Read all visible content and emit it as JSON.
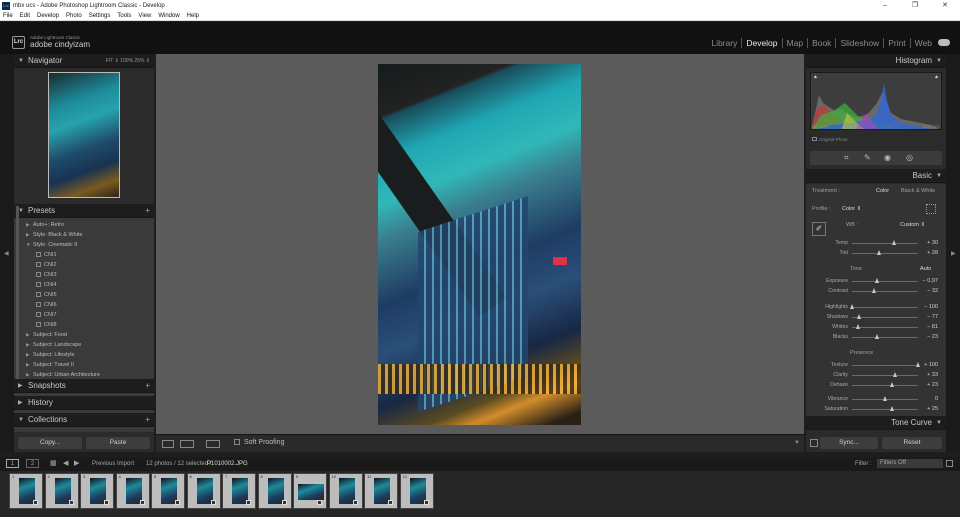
{
  "window": {
    "title": "mbx ucs - Adobe Photoshop Lightroom Classic - Develop",
    "controls": [
      "–",
      "❐",
      "✕"
    ]
  },
  "menu": [
    "File",
    "Edit",
    "Develop",
    "Photo",
    "Settings",
    "Tools",
    "View",
    "Window",
    "Help"
  ],
  "identity": {
    "badge": "Lrc",
    "app": "Adobe Lightroom Classic",
    "user": "adobe cindyizam"
  },
  "modules": [
    {
      "label": "Library",
      "active": false
    },
    {
      "label": "Develop",
      "active": true
    },
    {
      "label": "Map",
      "active": false
    },
    {
      "label": "Book",
      "active": false
    },
    {
      "label": "Slideshow",
      "active": false
    },
    {
      "label": "Print",
      "active": false
    },
    {
      "label": "Web",
      "active": false
    }
  ],
  "left": {
    "navigator": {
      "title": "Navigator",
      "zoom": "FIT ⇕   100%   25% ⇕"
    },
    "presets": {
      "title": "Presets",
      "items": [
        {
          "label": "Auto+: Retro",
          "level": 0,
          "open": false
        },
        {
          "label": "Style: Black & White",
          "level": 0,
          "open": false
        },
        {
          "label": "Style: Cinematic II",
          "level": 0,
          "open": true
        },
        {
          "label": "CNI1",
          "level": 1
        },
        {
          "label": "CNI2",
          "level": 1
        },
        {
          "label": "CNI3",
          "level": 1
        },
        {
          "label": "CNI4",
          "level": 1
        },
        {
          "label": "CNI5",
          "level": 1
        },
        {
          "label": "CNI6",
          "level": 1
        },
        {
          "label": "CNI7",
          "level": 1
        },
        {
          "label": "CNI8",
          "level": 1
        },
        {
          "label": "Subject: Food",
          "level": 0,
          "open": false
        },
        {
          "label": "Subject: Landscape",
          "level": 0,
          "open": false
        },
        {
          "label": "Subject: Lifestyle",
          "level": 0,
          "open": false
        },
        {
          "label": "Subject: Travel II",
          "level": 0,
          "open": false
        },
        {
          "label": "Subject: Urban Architecture",
          "level": 0,
          "open": false
        }
      ]
    },
    "snapshots": "Snapshots",
    "history": "History",
    "collections": "Collections",
    "copy": "Copy...",
    "paste": "Paste"
  },
  "toolbar": {
    "soft_proofing": "Soft Proofing"
  },
  "right": {
    "histogram": {
      "title": "Histogram",
      "left_info": "ISO 800",
      "dash1": "--",
      "dash2": "--",
      "right_info": "1/10 sec",
      "original": "Original Photo"
    },
    "basic": {
      "title": "Basic",
      "treatment_label": "Treatment :",
      "treatment_color": "Color",
      "treatment_bw": "Black & White",
      "profile_label": "Profile :",
      "profile_value": "Color ⇕",
      "wb_label": "WB :",
      "wb_value": "Custom ⇕",
      "tone_label": "Tone",
      "tone_auto": "Auto",
      "presence_label": "Presence"
    },
    "sliders": [
      {
        "label": "Temp",
        "value": "+ 30",
        "pos": 0.65
      },
      {
        "label": "Tint",
        "value": "+ 28",
        "pos": 0.42
      },
      {
        "label": "Exposure",
        "value": "− 0,97",
        "pos": 0.38
      },
      {
        "label": "Contrast",
        "value": "− 32",
        "pos": 0.34
      },
      {
        "label": "Highlights",
        "value": "− 100",
        "pos": 0.0
      },
      {
        "label": "Shadows",
        "value": "− 77",
        "pos": 0.12
      },
      {
        "label": "Whites",
        "value": "− 81",
        "pos": 0.1
      },
      {
        "label": "Blacks",
        "value": "− 23",
        "pos": 0.38
      },
      {
        "label": "Texture",
        "value": "+ 100",
        "pos": 1.0
      },
      {
        "label": "Clarity",
        "value": "+ 33",
        "pos": 0.66
      },
      {
        "label": "Dehaze",
        "value": "+ 23",
        "pos": 0.62
      },
      {
        "label": "Vibrance",
        "value": "0",
        "pos": 0.5
      },
      {
        "label": "Saturation",
        "value": "+ 25",
        "pos": 0.62
      }
    ],
    "tone_curve": "Tone Curve",
    "sync": "Sync...",
    "reset": "Reset"
  },
  "filmbar": {
    "page1": "1",
    "page2": "2",
    "source": "Previous Import",
    "count": "12 photos / 12 selected /",
    "file": "P1010002.JPG",
    "filter_label": "Filter :",
    "filter_value": "Filters Off"
  },
  "filmstrip": [
    {
      "num": "1"
    },
    {
      "num": "2"
    },
    {
      "num": "3"
    },
    {
      "num": "4"
    },
    {
      "num": "5"
    },
    {
      "num": "6"
    },
    {
      "num": "7"
    },
    {
      "num": "8"
    },
    {
      "num": "9"
    },
    {
      "num": "10"
    },
    {
      "num": "11"
    },
    {
      "num": "12"
    }
  ],
  "colors": {
    "accent": "#e8e8e8",
    "panel": "#2b2b2b",
    "canvas": "#5b5b5b"
  }
}
